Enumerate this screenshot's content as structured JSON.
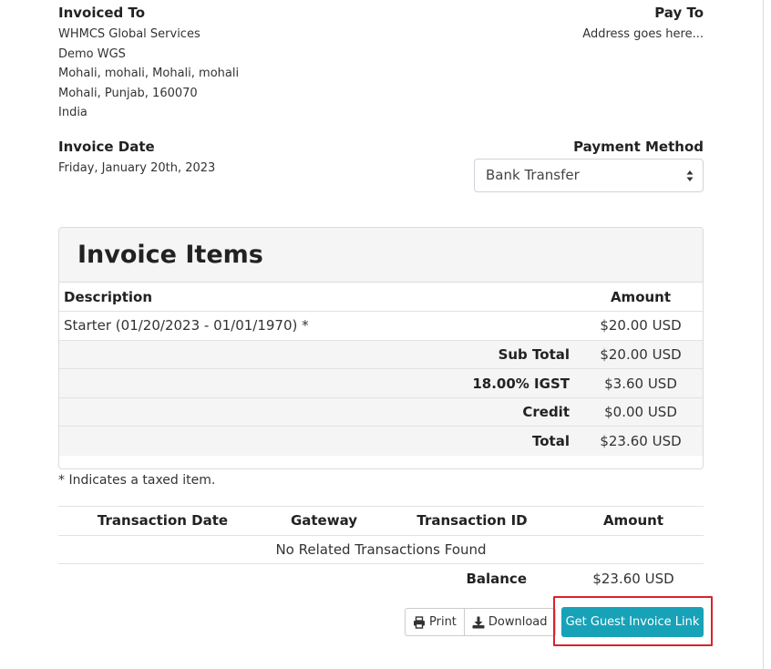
{
  "invoiced_to": {
    "title": "Invoiced To",
    "lines": [
      "WHMCS Global Services",
      "Demo WGS",
      "Mohali, mohali, Mohali, mohali",
      "Mohali, Punjab, 160070",
      "India"
    ]
  },
  "pay_to": {
    "title": "Pay To",
    "address": "Address goes here..."
  },
  "invoice_date": {
    "title": "Invoice Date",
    "value": "Friday, January 20th, 2023"
  },
  "payment_method": {
    "title": "Payment Method",
    "selected": "Bank Transfer"
  },
  "invoice_items": {
    "heading": "Invoice Items",
    "col_description": "Description",
    "col_amount": "Amount",
    "items": [
      {
        "description": "Starter (01/20/2023 - 01/01/1970) *",
        "amount": "$20.00 USD"
      }
    ],
    "summary": [
      {
        "label": "Sub Total",
        "value": "$20.00 USD"
      },
      {
        "label": "18.00% IGST",
        "value": "$3.60 USD"
      },
      {
        "label": "Credit",
        "value": "$0.00 USD"
      },
      {
        "label": "Total",
        "value": "$23.60 USD"
      }
    ]
  },
  "tax_note": "* Indicates a taxed item.",
  "transactions": {
    "headers": [
      "Transaction Date",
      "Gateway",
      "Transaction ID",
      "Amount"
    ],
    "empty_message": "No Related Transactions Found",
    "balance_label": "Balance",
    "balance_value": "$23.60 USD"
  },
  "actions": {
    "print_label": "Print",
    "download_label": "Download",
    "guest_link_label": "Get Guest Invoice Link"
  },
  "colors": {
    "accent": "#17a2b8",
    "highlight": "#d9232e"
  }
}
